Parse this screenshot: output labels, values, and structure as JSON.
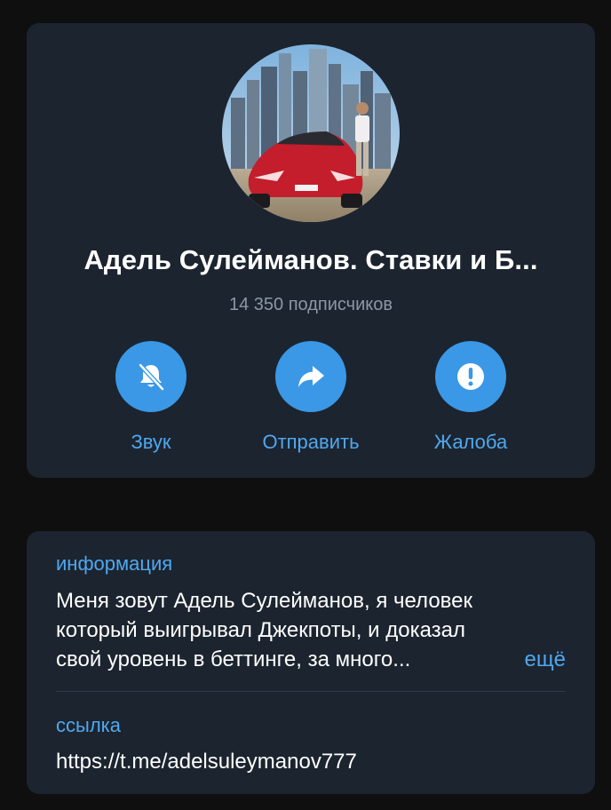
{
  "channel": {
    "title": "Адель Сулейманов. Ставки и Б...",
    "subscribers": "14 350 подписчиков",
    "avatar_icon": "avatar-photo-red-sports-car-city-skyline"
  },
  "actions": {
    "sound_label": "Звук",
    "sound_icon": "bell-muted-icon",
    "share_label": "Отправить",
    "share_icon": "share-arrow-icon",
    "report_label": "Жалоба",
    "report_icon": "exclamation-circle-icon"
  },
  "info": {
    "section_label": "информация",
    "about_lines": [
      "Меня зовут Адель Сулейманов, я человек",
      "который выигрывал Джекпоты, и доказал",
      "свой уровень в беттинге, за много..."
    ],
    "more_label": "ещё",
    "link_label": "ссылка",
    "link_value": "https://t.me/adelsuleymanov777"
  },
  "colors": {
    "background": "#0f0f10",
    "card": "#1c242f",
    "accent": "#4fa8ef",
    "button_fill": "#3a98e6",
    "secondary_text": "#8c98a6"
  }
}
